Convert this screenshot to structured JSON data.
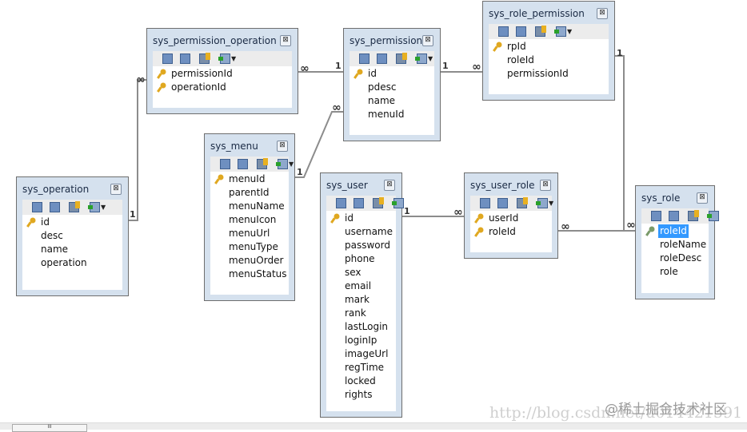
{
  "tables": [
    {
      "name": "sys_operation",
      "fields": [
        {
          "n": "id",
          "pk": true
        },
        {
          "n": "desc"
        },
        {
          "n": "name"
        },
        {
          "n": "operation"
        }
      ]
    },
    {
      "name": "sys_permission_operation",
      "fields": [
        {
          "n": "permissionId",
          "pk": true
        },
        {
          "n": "operationId",
          "pk": true
        }
      ]
    },
    {
      "name": "sys_permission",
      "fields": [
        {
          "n": "id",
          "pk": true
        },
        {
          "n": "pdesc"
        },
        {
          "n": "name"
        },
        {
          "n": "menuId"
        }
      ]
    },
    {
      "name": "sys_role_permission",
      "fields": [
        {
          "n": "rpId",
          "pk": true
        },
        {
          "n": "roleId"
        },
        {
          "n": "permissionId"
        }
      ]
    },
    {
      "name": "sys_menu",
      "fields": [
        {
          "n": "menuId",
          "pk": true
        },
        {
          "n": "parentId"
        },
        {
          "n": "menuName"
        },
        {
          "n": "menuIcon"
        },
        {
          "n": "menuUrl"
        },
        {
          "n": "menuType"
        },
        {
          "n": "menuOrder"
        },
        {
          "n": "menuStatus"
        }
      ]
    },
    {
      "name": "sys_user",
      "fields": [
        {
          "n": "id",
          "pk": true
        },
        {
          "n": "username"
        },
        {
          "n": "password"
        },
        {
          "n": "phone"
        },
        {
          "n": "sex"
        },
        {
          "n": "email"
        },
        {
          "n": "mark"
        },
        {
          "n": "rank"
        },
        {
          "n": "lastLogin"
        },
        {
          "n": "loginIp"
        },
        {
          "n": "imageUrl"
        },
        {
          "n": "regTime"
        },
        {
          "n": "locked"
        },
        {
          "n": "rights"
        }
      ]
    },
    {
      "name": "sys_user_role",
      "fields": [
        {
          "n": "userId",
          "pk": true
        },
        {
          "n": "roleId",
          "pk": true
        }
      ]
    },
    {
      "name": "sys_role",
      "fields": [
        {
          "n": "roleId",
          "pk": true,
          "selected": true
        },
        {
          "n": "roleName"
        },
        {
          "n": "roleDesc"
        },
        {
          "n": "role"
        }
      ]
    }
  ],
  "cardinality": [
    "1",
    "∞",
    "∞",
    "1",
    "1",
    "∞",
    "1",
    "∞",
    "1",
    "∞",
    "∞",
    "1",
    "∞"
  ],
  "close_glyph": "⊠",
  "colors": {
    "pk_key": "#e0a820",
    "selected_key": "#7a9a6a",
    "selection": "#3399ff",
    "line": "#8c8c8c"
  },
  "watermark": {
    "url": "http://blog.csdn.net/u014421591",
    "site": "@稀土掘金技术社区"
  },
  "scrollbar_grip": "III"
}
